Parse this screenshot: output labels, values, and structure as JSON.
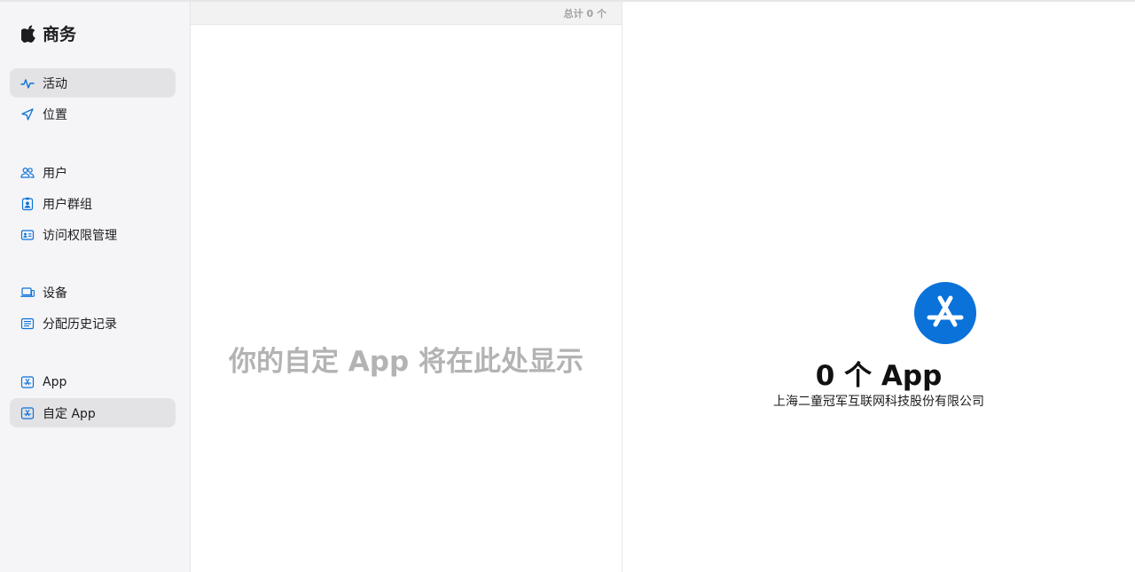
{
  "brand": {
    "title": "商务",
    "logo_icon": "apple-logo"
  },
  "sidebar": {
    "items": [
      {
        "label": "活动",
        "icon": "activity-icon",
        "selected": true
      },
      {
        "label": "位置",
        "icon": "location-arrow-icon",
        "selected": false
      },
      {
        "label": "用户",
        "icon": "users-icon",
        "selected": false
      },
      {
        "label": "用户群组",
        "icon": "user-group-badge-icon",
        "selected": false
      },
      {
        "label": "访问权限管理",
        "icon": "id-card-icon",
        "selected": false
      },
      {
        "label": "设备",
        "icon": "laptop-icon",
        "selected": false
      },
      {
        "label": "分配历史记录",
        "icon": "list-history-icon",
        "selected": false
      },
      {
        "label": "App",
        "icon": "app-store-square-icon",
        "selected": false
      },
      {
        "label": "自定 App",
        "icon": "app-store-square-icon",
        "selected": true
      }
    ]
  },
  "list": {
    "total_label": "总计 0 个",
    "empty_message": "你的自定 App 将在此处显示"
  },
  "detail": {
    "icon": "app-store-icon",
    "count_title": "0 个 App",
    "organization": "上海二童冠军互联网科技股份有限公司"
  },
  "colors": {
    "accent": "#0a72d9",
    "sidebar_bg": "#f5f5f7",
    "selected_bg": "#e3e3e5",
    "empty_text": "#b3b3b3"
  }
}
